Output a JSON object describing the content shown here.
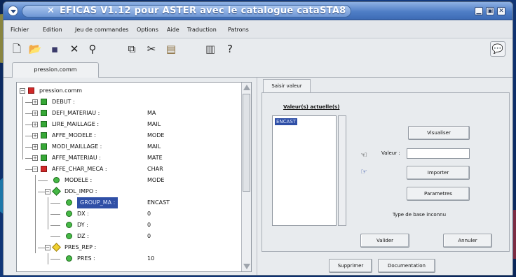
{
  "window": {
    "title": "EFICAS V1.12 pour ASTER avec le catalogue cataSTA8",
    "controls": [
      "▁",
      "▣",
      "✕"
    ]
  },
  "menubar": {
    "items": [
      "Fichier",
      "Edition",
      "Jeu de commandes",
      "Options",
      "Aide",
      "Traduction",
      "Patrons"
    ]
  },
  "toolbar": {
    "icons": [
      "new-file-icon",
      "open-folder-icon",
      "save-icon",
      "close-icon",
      "search-icon",
      "copy-icon",
      "cut-icon",
      "paste-icon",
      "delete-icon",
      "help-icon",
      "tooltip-icon"
    ]
  },
  "file_tab": {
    "label": "pression.comm"
  },
  "tree": {
    "rows": [
      {
        "name": "pression.comm",
        "value": "",
        "icon": "red-square",
        "indent": 0,
        "expander": "−"
      },
      {
        "name": "DEBUT :",
        "value": "",
        "icon": "green-square",
        "indent": 1,
        "expander": "+"
      },
      {
        "name": "DEFI_MATERIAU :",
        "value": "MA",
        "icon": "green-square",
        "indent": 1,
        "expander": "+"
      },
      {
        "name": "LIRE_MAILLAGE :",
        "value": "MAIL",
        "icon": "green-square",
        "indent": 1,
        "expander": "+"
      },
      {
        "name": "AFFE_MODELE :",
        "value": "MODE",
        "icon": "green-square",
        "indent": 1,
        "expander": "+"
      },
      {
        "name": "MODI_MAILLAGE :",
        "value": "MAIL",
        "icon": "green-square",
        "indent": 1,
        "expander": "+"
      },
      {
        "name": "AFFE_MATERIAU :",
        "value": "MATE",
        "icon": "green-square",
        "indent": 1,
        "expander": "+"
      },
      {
        "name": "AFFE_CHAR_MECA :",
        "value": "CHAR",
        "icon": "red-square",
        "indent": 1,
        "expander": "−"
      },
      {
        "name": "MODELE :",
        "value": "MODE",
        "icon": "green-circle",
        "indent": 2,
        "expander": ""
      },
      {
        "name": "DDL_IMPO :",
        "value": "",
        "icon": "green-diamond",
        "indent": 2,
        "expander": "−"
      },
      {
        "name": "GROUP_MA :",
        "value": "ENCAST",
        "icon": "green-circle",
        "indent": 3,
        "expander": "",
        "selected": true
      },
      {
        "name": "DX :",
        "value": "0",
        "icon": "green-circle",
        "indent": 3,
        "expander": ""
      },
      {
        "name": "DY :",
        "value": "0",
        "icon": "green-circle",
        "indent": 3,
        "expander": ""
      },
      {
        "name": "DZ :",
        "value": "0",
        "icon": "green-circle",
        "indent": 3,
        "expander": ""
      },
      {
        "name": "PRES_REP :",
        "value": "",
        "icon": "yellow-diamond",
        "indent": 2,
        "expander": "−"
      },
      {
        "name": "PRES :",
        "value": "10",
        "icon": "green-circle",
        "indent": 3,
        "expander": ""
      }
    ]
  },
  "edit_panel": {
    "tab_label": "Saisir valeur",
    "current_values_label": "Valeur(s) actuelle(s)",
    "current_values": [
      "ENCAST"
    ],
    "visualiser_label": "Visualiser",
    "valeur_label": "Valeur :",
    "valeur_value": "",
    "importer_label": "Importer",
    "parametres_label": "Parametres",
    "type_text": "Type de base inconnu",
    "valider_label": "Valider",
    "annuler_label": "Annuler"
  },
  "bottom": {
    "supprimer_label": "Supprimer",
    "documentation_label": "Documentation"
  },
  "colors": {
    "titlebar": "#4f7ec6",
    "selection": "#2f4fa6",
    "error_node": "#d02828",
    "ok_node": "#37a837",
    "warning_node": "#f0d030"
  }
}
